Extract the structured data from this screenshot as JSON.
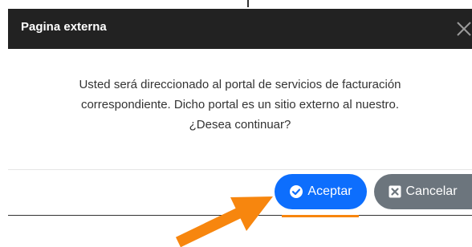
{
  "modal": {
    "title": "Pagina externa",
    "close_symbol": "×",
    "message_lines": [
      "Usted será direccionado al portal de servicios de facturación",
      "correspondiente. Dicho portal es un sitio externo al nuestro.",
      "¿Desea continuar?"
    ],
    "accept_label": "Aceptar",
    "cancel_label": "Cancelar",
    "accept_icon": "check-circle-icon",
    "cancel_icon": "x-square-icon"
  },
  "annotation": {
    "arrow_icon": "pointer-arrow-icon",
    "color": "#f7860e"
  },
  "colors": {
    "header_bg": "#222222",
    "accept_bg": "#0d6efd",
    "cancel_bg": "#6c757d"
  }
}
